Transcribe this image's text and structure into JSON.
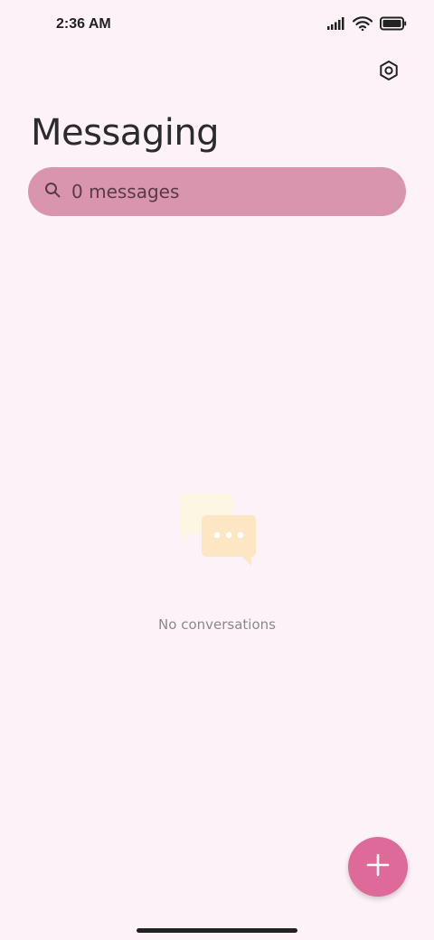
{
  "status_bar": {
    "time": "2:36 AM",
    "icons": [
      "signal-icon",
      "wifi-icon",
      "battery-icon"
    ]
  },
  "header": {
    "title": "Messaging",
    "settings_icon": "settings-icon"
  },
  "search": {
    "text": "0 messages",
    "icon": "search-icon"
  },
  "empty_state": {
    "illustration": "chat-bubbles-icon",
    "message": "No conversations"
  },
  "fab": {
    "icon": "plus-icon"
  },
  "colors": {
    "background": "#FDF2F8",
    "search_bar": "#D994AE",
    "fab": "#DE6A9A",
    "bubble_back": "#FCF6E2",
    "bubble_front": "#FCE6C4"
  }
}
